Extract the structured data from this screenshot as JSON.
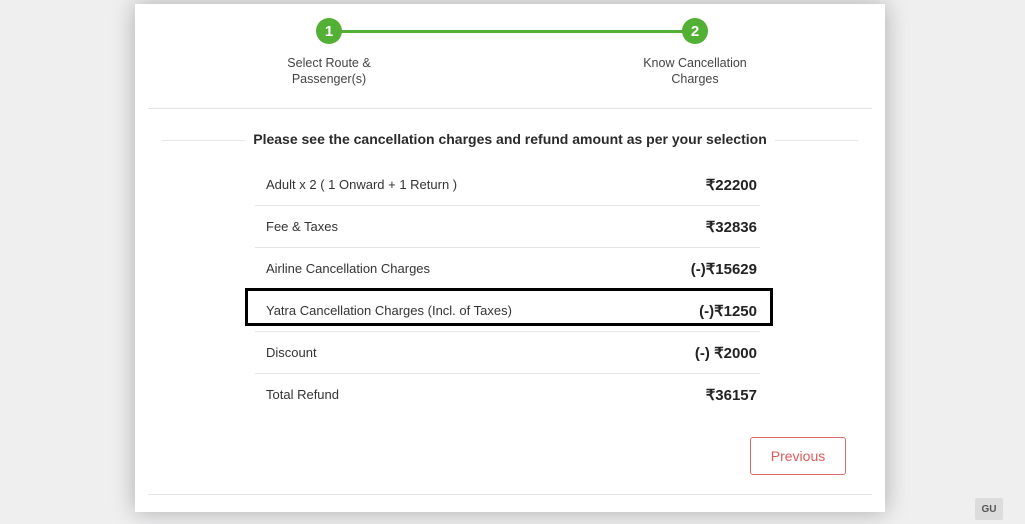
{
  "stepper": {
    "steps": [
      {
        "number": "1",
        "label_line1": "Select Route &",
        "label_line2": "Passenger(s)"
      },
      {
        "number": "2",
        "label_line1": "Know Cancellation",
        "label_line2": "Charges"
      }
    ],
    "active_color": "#52b135"
  },
  "heading": "Please see the cancellation charges and refund amount as per your selection",
  "charges": [
    {
      "name": "Adult x 2 ( 1 Onward + 1 Return )",
      "amount": "₹22200"
    },
    {
      "name": "Fee & Taxes",
      "amount": "₹32836"
    },
    {
      "name": "Airline Cancellation Charges",
      "amount": "(-)₹15629"
    },
    {
      "name": "Yatra Cancellation Charges (Incl. of Taxes)",
      "amount": "(-)₹1250"
    },
    {
      "name": "Discount",
      "amount": "(-) ₹2000"
    },
    {
      "name": "Total Refund",
      "amount": "₹36157"
    }
  ],
  "buttons": {
    "previous": "Previous"
  },
  "watermark": "GU",
  "colors": {
    "accent_green": "#52b135",
    "button_red": "#e05a5a"
  }
}
